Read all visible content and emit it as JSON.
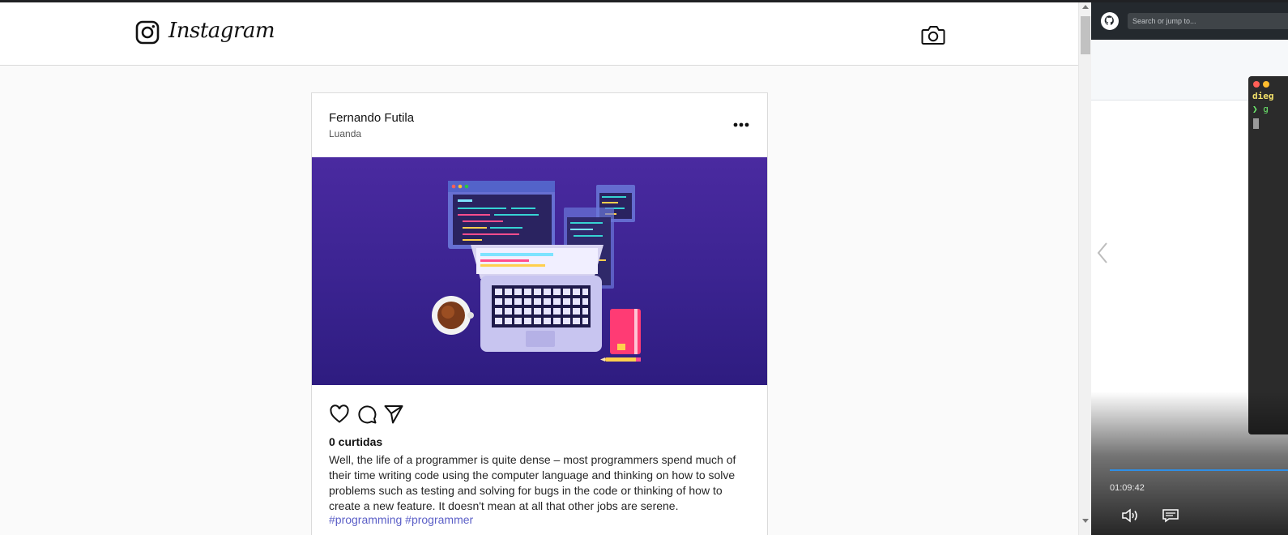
{
  "header": {
    "logo_text": "Instagram",
    "logo_icon": "instagram-glyph-icon",
    "camera_icon": "camera-icon"
  },
  "post": {
    "author": "Fernando Futila",
    "location": "Luanda",
    "likes": "0 curtidas",
    "caption": "Well, the life of a programmer is quite dense – most programmers spend much of their time writing code using the computer language and thinking on how to solve problems such as testing and solving for bugs in the code or thinking of how to create a new feature. It doesn't mean at all that other jobs are serene.",
    "hashtags": "#programming #programmer",
    "image_alt": "programmer illustration",
    "icons": [
      "heart-icon",
      "comment-icon",
      "share-icon",
      "more-options-icon"
    ]
  },
  "video_panel": {
    "search_placeholder": "Search or jump to...",
    "terminal_line1": "dieg",
    "terminal_line2": "❯ g",
    "timecode": "01:09:42",
    "colors": {
      "github_bar": "#24292e",
      "progress": "#2f8fe6"
    }
  },
  "colors": {
    "accent_link": "#5b5fc7",
    "image_bg": "#3c2492"
  }
}
